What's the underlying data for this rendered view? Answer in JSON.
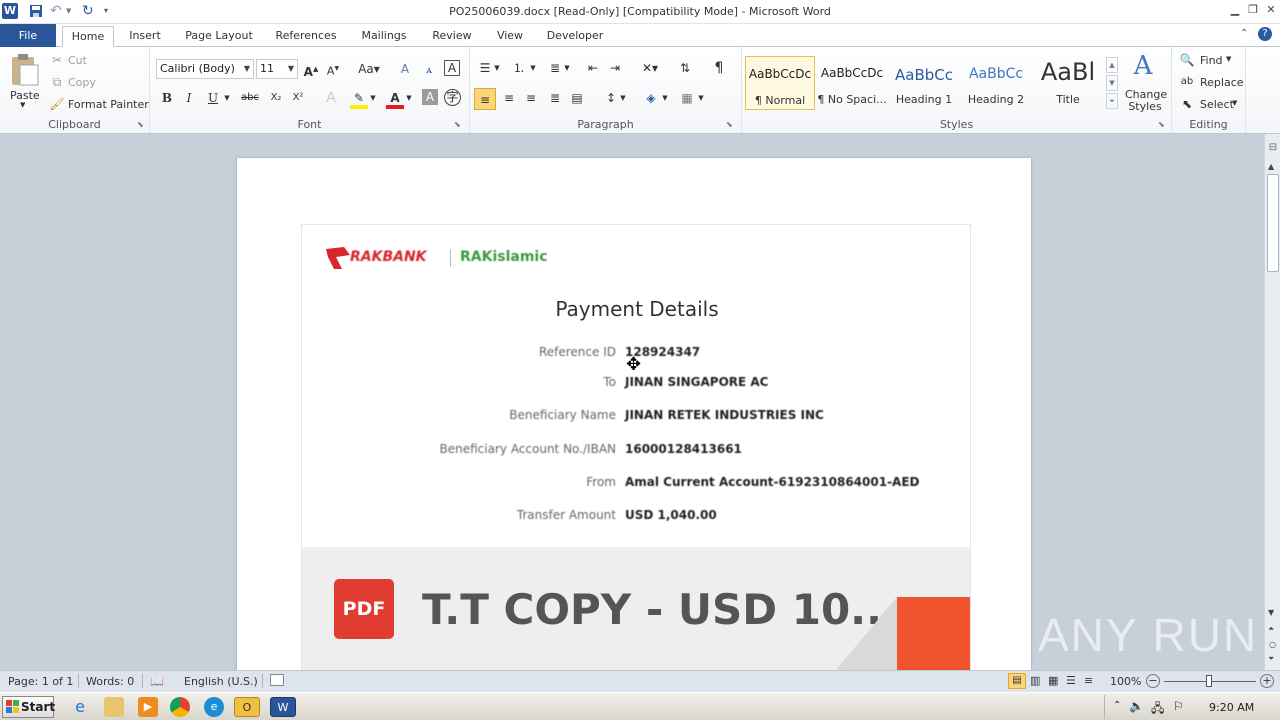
{
  "window": {
    "title": "PO25006039.docx [Read-Only] [Compatibility Mode] - Microsoft Word",
    "app_icon": "W"
  },
  "tabs": [
    "File",
    "Home",
    "Insert",
    "Page Layout",
    "References",
    "Mailings",
    "Review",
    "View",
    "Developer"
  ],
  "ribbon": {
    "clipboard": {
      "label": "Clipboard",
      "paste": "Paste",
      "cut": "Cut",
      "copy": "Copy",
      "format_painter": "Format Painter"
    },
    "font": {
      "label": "Font",
      "font_name": "Calibri (Body)",
      "font_size": "11",
      "bold": "B",
      "italic": "I",
      "underline": "U",
      "strike": "abc",
      "subscript": "X₂",
      "superscript": "X²"
    },
    "paragraph": {
      "label": "Paragraph"
    },
    "styles": {
      "label": "Styles",
      "items": [
        {
          "preview": "AaBbCcDc",
          "name": "¶ Normal"
        },
        {
          "preview": "AaBbCcDc",
          "name": "¶ No Spaci..."
        },
        {
          "preview": "AaBbCc",
          "name": "Heading 1"
        },
        {
          "preview": "AaBbCc",
          "name": "Heading 2"
        },
        {
          "preview": "AaBl",
          "name": "Title"
        }
      ],
      "change_styles": "Change Styles"
    },
    "editing": {
      "label": "Editing",
      "find": "Find",
      "replace": "Replace",
      "select": "Select"
    }
  },
  "document": {
    "bank_name": "RAKBANK",
    "bank_name2": "RAKislamic",
    "heading": "Payment Details",
    "rows": [
      {
        "label": "Reference ID",
        "value": "128924347"
      },
      {
        "label": "To",
        "value": "JINAN SINGAPORE AC"
      },
      {
        "label": "Beneficiary Name",
        "value": "JINAN RETEK INDUSTRIES INC"
      },
      {
        "label": "Beneficiary Account No./IBAN",
        "value": "16000128413661"
      },
      {
        "label": "From",
        "value": "Amal Current Account-6192310864001-AED"
      },
      {
        "label": "Transfer Amount",
        "value": "USD 1,040.00"
      }
    ],
    "pdf_badge": "PDF",
    "pdf_title": "T.T COPY - USD 10..."
  },
  "statusbar": {
    "page": "Page: 1 of 1",
    "words": "Words: 0",
    "language": "English (U.S.)",
    "zoom": "100%"
  },
  "taskbar": {
    "start": "Start",
    "clock": "9:20 AM"
  },
  "watermark": "ANY RUN",
  "colors": {
    "file_tab": "#2a5699",
    "doc_background": "#c7cfd9",
    "brand_red": "#d7262e",
    "brand_green": "#3c9a3f",
    "pdf_red": "#e03c31",
    "banner_orange": "#f0532d"
  }
}
